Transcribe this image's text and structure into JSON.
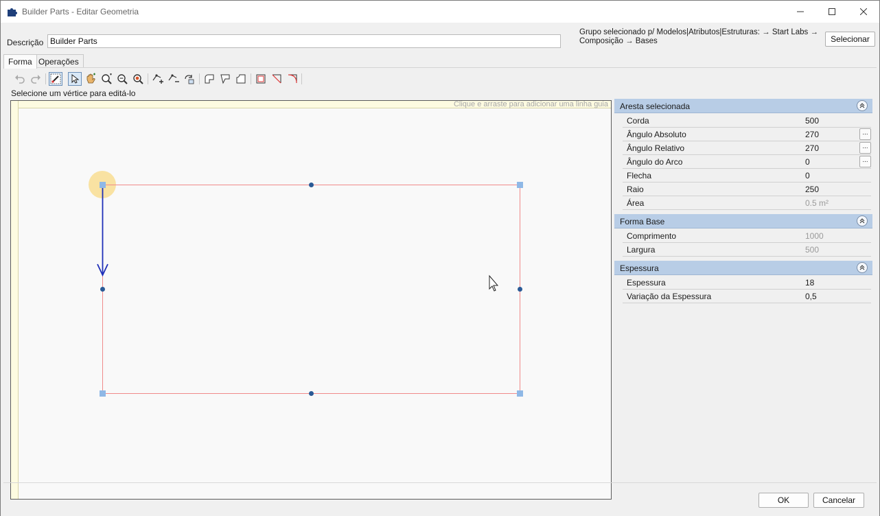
{
  "window": {
    "title": "Builder Parts - Editar Geometria"
  },
  "header": {
    "description_label": "Descrição",
    "description_value": "Builder Parts",
    "group_line1": "Grupo selecionado p/ Modelos|Atributos|Estruturas:  → Start Labs →",
    "group_line2": "Composição → Bases",
    "select_button": "Selecionar"
  },
  "tabs": [
    {
      "label": "Forma",
      "active": true
    },
    {
      "label": "Operações",
      "active": false
    }
  ],
  "toolbar": {
    "icons": [
      "undo-icon",
      "redo-icon",
      "edit-vertex-icon",
      "select-pointer-icon",
      "pan-hand-icon",
      "zoom-in-icon",
      "zoom-out-icon",
      "zoom-fit-icon",
      "add-point-icon",
      "remove-point-icon",
      "rotate-shape-icon",
      "corner-round-icon",
      "corner-chamfer-icon",
      "corner-notch-icon",
      "corner-square-icon",
      "corner-cut-icon",
      "corner-arc-icon"
    ]
  },
  "canvas": {
    "hint": "Selecione um vértice para editá-lo",
    "guide_hint": "Clique e arraste para adicionar uma linha guia"
  },
  "properties": {
    "selected_edge": {
      "title": "Aresta selecionada",
      "rows": [
        {
          "name": "Corda",
          "value": "500",
          "readonly": false,
          "button": false
        },
        {
          "name": "Ângulo Absoluto",
          "value": "270",
          "readonly": false,
          "button": true
        },
        {
          "name": "Ângulo Relativo",
          "value": "270",
          "readonly": false,
          "button": true
        },
        {
          "name": "Ângulo do Arco",
          "value": "0",
          "readonly": false,
          "button": true
        },
        {
          "name": "Flecha",
          "value": "0",
          "readonly": false,
          "button": false
        },
        {
          "name": "Raio",
          "value": "250",
          "readonly": false,
          "button": false
        },
        {
          "name": "Área",
          "value": "0.5 m²",
          "readonly": true,
          "button": false
        }
      ]
    },
    "base_shape": {
      "title": "Forma Base",
      "rows": [
        {
          "name": "Comprimento",
          "value": "1000",
          "readonly": true
        },
        {
          "name": "Largura",
          "value": "500",
          "readonly": true
        }
      ]
    },
    "thickness": {
      "title": "Espessura",
      "rows": [
        {
          "name": "Espessura",
          "value": "18",
          "readonly": false
        },
        {
          "name": "Variação da Espessura",
          "value": "0,5",
          "readonly": false
        }
      ]
    },
    "ellipsis": "..."
  },
  "footer": {
    "ok": "OK",
    "cancel": "Cancelar"
  },
  "colors": {
    "shape_edge": "#f08a8a",
    "selected_edge": "#1f2fb8",
    "vertex": "#8fb8e6",
    "midpoint": "#2a5a96",
    "highlight": "#f9dc8c"
  }
}
